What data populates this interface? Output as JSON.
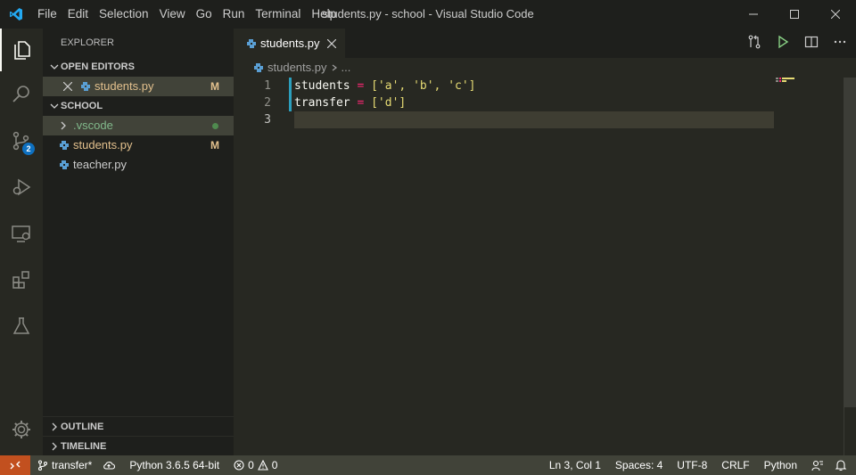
{
  "titlebar": {
    "menu": [
      "File",
      "Edit",
      "Selection",
      "View",
      "Go",
      "Run",
      "Terminal",
      "Help"
    ],
    "title": "students.py - school - Visual Studio Code"
  },
  "activity": {
    "scm_badge": "2"
  },
  "sidebar": {
    "title": "EXPLORER",
    "open_editors": {
      "header": "OPEN EDITORS",
      "items": [
        {
          "name": "students.py",
          "status": "M"
        }
      ]
    },
    "folder": {
      "header": "SCHOOL",
      "items": [
        {
          "name": ".vscode",
          "type": "folder"
        },
        {
          "name": "students.py",
          "status": "M"
        },
        {
          "name": "teacher.py",
          "status": ""
        }
      ]
    },
    "outline": "OUTLINE",
    "timeline": "TIMELINE"
  },
  "editor": {
    "tab": "students.py",
    "breadcrumb_file": "students.py",
    "breadcrumb_more": "...",
    "lines": [
      {
        "num": "1",
        "var": "students",
        "op": "=",
        "values": "['a', 'b', 'c']"
      },
      {
        "num": "2",
        "var": "transfer",
        "op": "=",
        "values": "['d']"
      },
      {
        "num": "3"
      }
    ]
  },
  "status": {
    "branch": "transfer*",
    "python": "Python 3.6.5 64-bit",
    "errors": "0",
    "warnings": "0",
    "position": "Ln 3, Col 1",
    "spaces": "Spaces: 4",
    "encoding": "UTF-8",
    "eol": "CRLF",
    "language": "Python"
  },
  "colors": {
    "accent_blue": "#2c9fbd",
    "remote_orange": "#c2501f",
    "modified": "#e2c08d",
    "statusbar": "#414339"
  }
}
